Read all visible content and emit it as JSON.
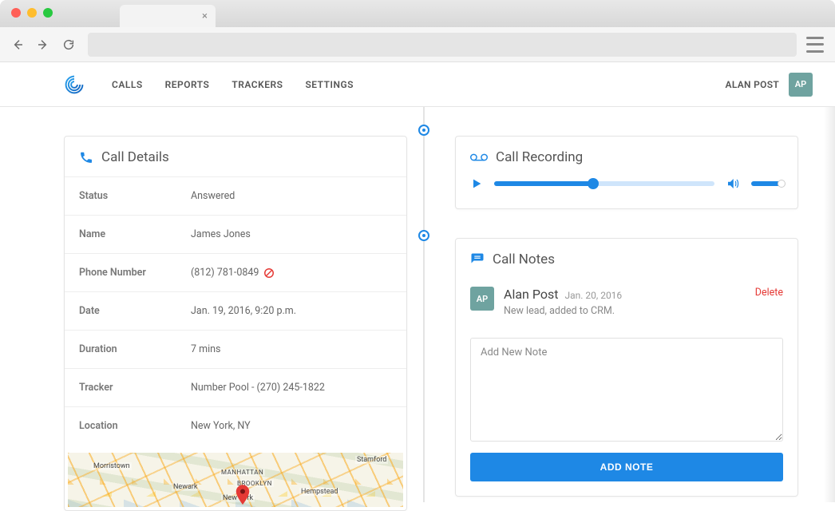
{
  "nav": {
    "items": [
      "CALLS",
      "REPORTS",
      "TRACKERS",
      "SETTINGS"
    ]
  },
  "user": {
    "name": "ALAN POST",
    "initials": "AP"
  },
  "call_details": {
    "title": "Call Details",
    "rows": {
      "status_label": "Status",
      "status_value": "Answered",
      "name_label": "Name",
      "name_value": "James Jones",
      "phone_label": "Phone Number",
      "phone_value": "(812) 781-0849",
      "date_label": "Date",
      "date_value": "Jan. 19, 2016, 9:20 p.m.",
      "duration_label": "Duration",
      "duration_value": "7 mins",
      "tracker_label": "Tracker",
      "tracker_value": "Number Pool - (270) 245-1822",
      "location_label": "Location",
      "location_value": "New York, NY"
    },
    "map_labels": {
      "morristown": "Morristown",
      "newark": "Newark",
      "manhattan": "MANHATTAN",
      "brooklyn": "BROOKLYN",
      "newyork": "New York",
      "hempstead": "Hempstead",
      "stamford": "Stamford"
    }
  },
  "recording": {
    "title": "Call Recording",
    "progress_pct": 45
  },
  "notes": {
    "title": "Call Notes",
    "items": [
      {
        "initials": "AP",
        "author": "Alan Post",
        "date": "Jan. 20, 2016",
        "text": "New lead, added to CRM.",
        "delete_label": "Delete"
      }
    ],
    "placeholder": "Add New Note",
    "add_button": "ADD NOTE"
  }
}
